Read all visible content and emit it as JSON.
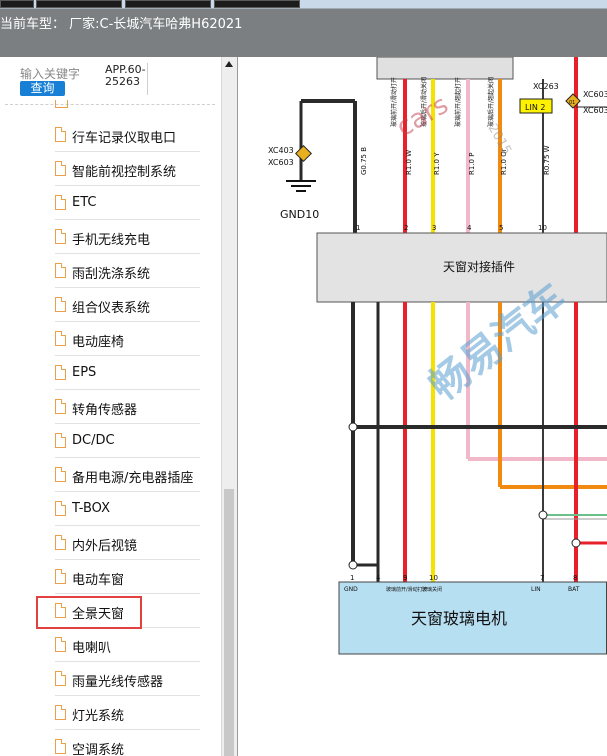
{
  "header": {
    "vehicle_label": "当前车型：",
    "vehicle_value": "厂家:C-长城汽车哈弗H62021"
  },
  "search": {
    "placeholder": "输入关键字",
    "button_label": "查询",
    "app_version": "APP.60-25263"
  },
  "sidebar": {
    "items": [
      {
        "label": "行车记录仪取电口"
      },
      {
        "label": "智能前视控制系统"
      },
      {
        "label": "ETC"
      },
      {
        "label": "手机无线充电"
      },
      {
        "label": "雨刮洗涤系统"
      },
      {
        "label": "组合仪表系统"
      },
      {
        "label": "电动座椅"
      },
      {
        "label": "EPS"
      },
      {
        "label": "转角传感器"
      },
      {
        "label": "DC/DC"
      },
      {
        "label": "备用电源/充电器插座"
      },
      {
        "label": "T-BOX"
      },
      {
        "label": "内外后视镜"
      },
      {
        "label": "电动车窗"
      },
      {
        "label": "全景天窗"
      },
      {
        "label": "电喇叭"
      },
      {
        "label": "雨量光线传感器"
      },
      {
        "label": "灯光系统"
      },
      {
        "label": "空调系统"
      }
    ],
    "selected": "全景天窗"
  },
  "diagram": {
    "connector_top": "XC263",
    "connector_right": "XC603",
    "lin2": "LIN 2",
    "gnd_conn_a": "XC403",
    "gnd_conn_b": "XC603",
    "gnd_label": "GND10",
    "plug_label": "天窗对接插件",
    "motor_label": "天窗玻璃电机",
    "diamond_label": "01",
    "wire_codes": [
      "G0.75 B",
      "R1.0 W",
      "R1.0 Y",
      "R1.0 P",
      "R1.0 Or",
      "R0.75 W"
    ],
    "wire_desc": [
      "玻璃前开/滑动打开",
      "玻璃后开/滑动关闭",
      "玻璃前开/翘起打开",
      "玻璃后开/翘起关闭"
    ],
    "plug_pins": [
      "1",
      "2",
      "3",
      "4",
      "5",
      "10"
    ],
    "motor_pins": [
      "1",
      "4",
      "9",
      "10",
      "7",
      "8"
    ],
    "motor_pin_labels": [
      "GND",
      "玻璃前开/滑动打开",
      "玻璃关闭",
      "LIN",
      "BAT"
    ],
    "watermark_a": "cars",
    "watermark_b": "畅易汽车",
    "watermark_c": "2015"
  },
  "colors": {
    "accent": "#1780d6",
    "highlight": "#e34040",
    "wire_red": "#e8202a",
    "wire_yellow": "#f5e200",
    "wire_pink": "#f0b8c8",
    "wire_orange": "#f08a10",
    "wire_black": "#222222",
    "motor_fill": "#b7dff2"
  }
}
